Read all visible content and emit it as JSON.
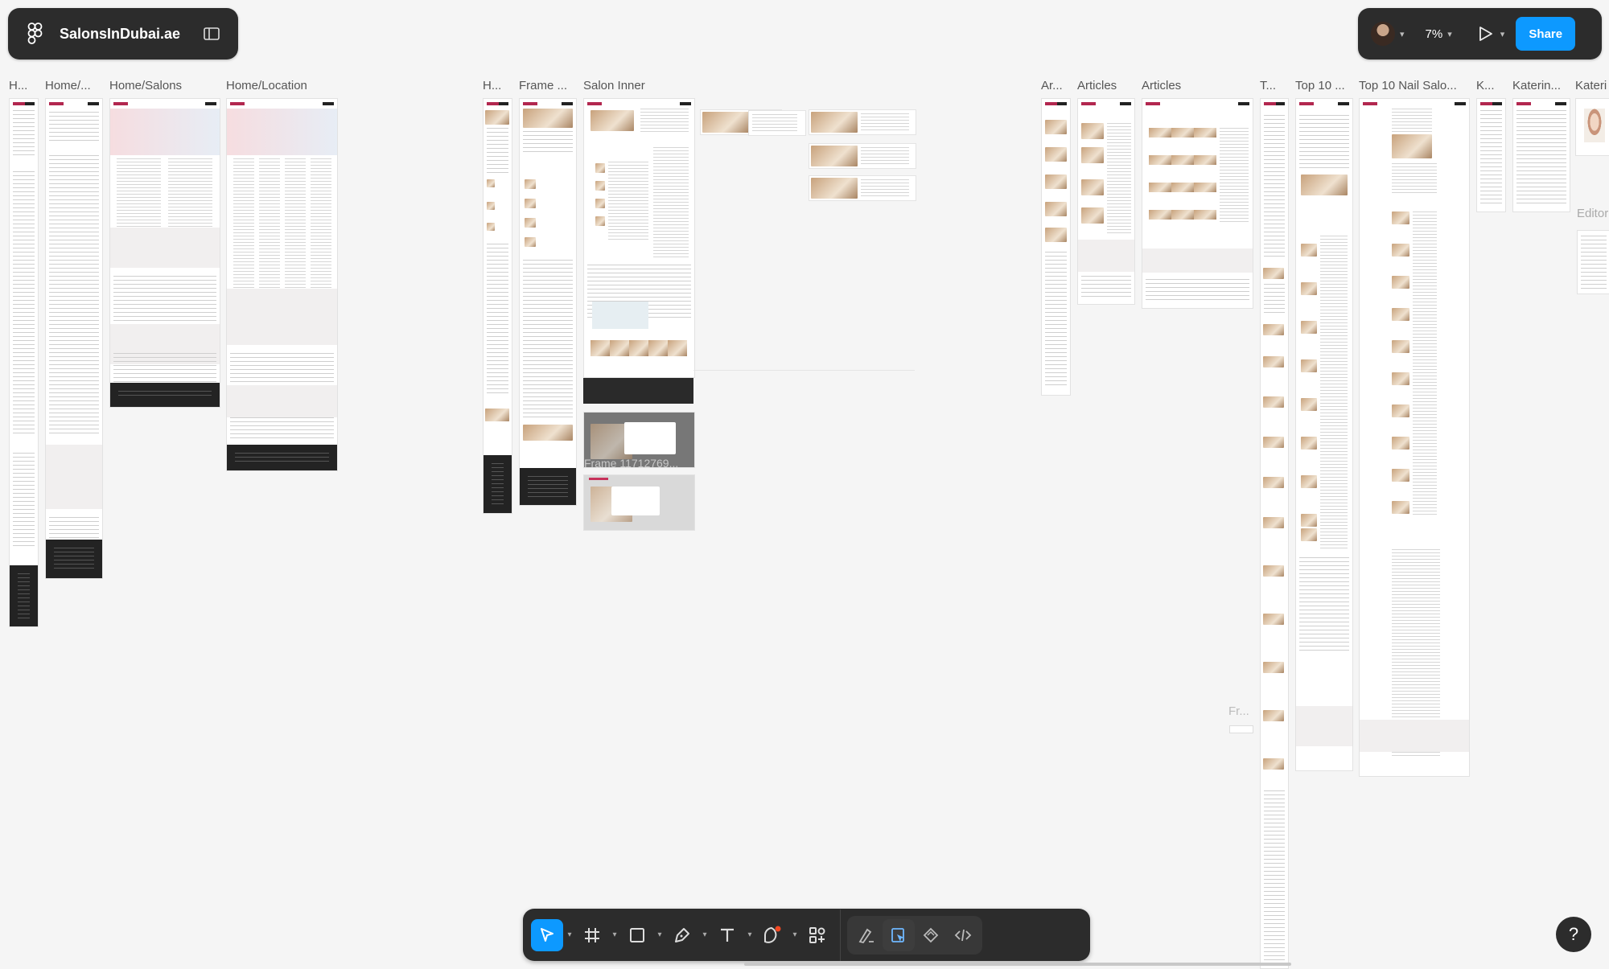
{
  "file_panel": {
    "filename": "SalonsInDubai.ae",
    "logo_icon": "figma-logo-icon",
    "toggle_icon": "sidebar-toggle-icon"
  },
  "header_right": {
    "zoom": "7%",
    "share_label": "Share"
  },
  "frame_labels": [
    "H...",
    "Home/...",
    "Home/Salons",
    "Home/Location",
    "H...",
    "Frame ...",
    "Salon Inner",
    "Ar...",
    "Articles",
    "Articles",
    "T...",
    "Top 10 ...",
    "Top 10 Nail Salo...",
    "K...",
    "Katerin...",
    "Kateri",
    "Fr...",
    "Editor"
  ],
  "canvas_ghost_labels": [
    "Frame 11712769..."
  ],
  "toolbar": {
    "tools": [
      "move-tool",
      "frame-tool",
      "rectangle-tool",
      "pen-tool",
      "text-tool",
      "comment-tool",
      "actions-tool"
    ],
    "dev_tools": [
      "draw-mode",
      "design-mode",
      "prototype-mode",
      "dev-mode"
    ]
  },
  "help_label": "?",
  "colors": {
    "accent": "#0d99ff",
    "brand": "#b2274f",
    "panel": "#2c2c2c",
    "canvas": "#f5f5f5"
  }
}
